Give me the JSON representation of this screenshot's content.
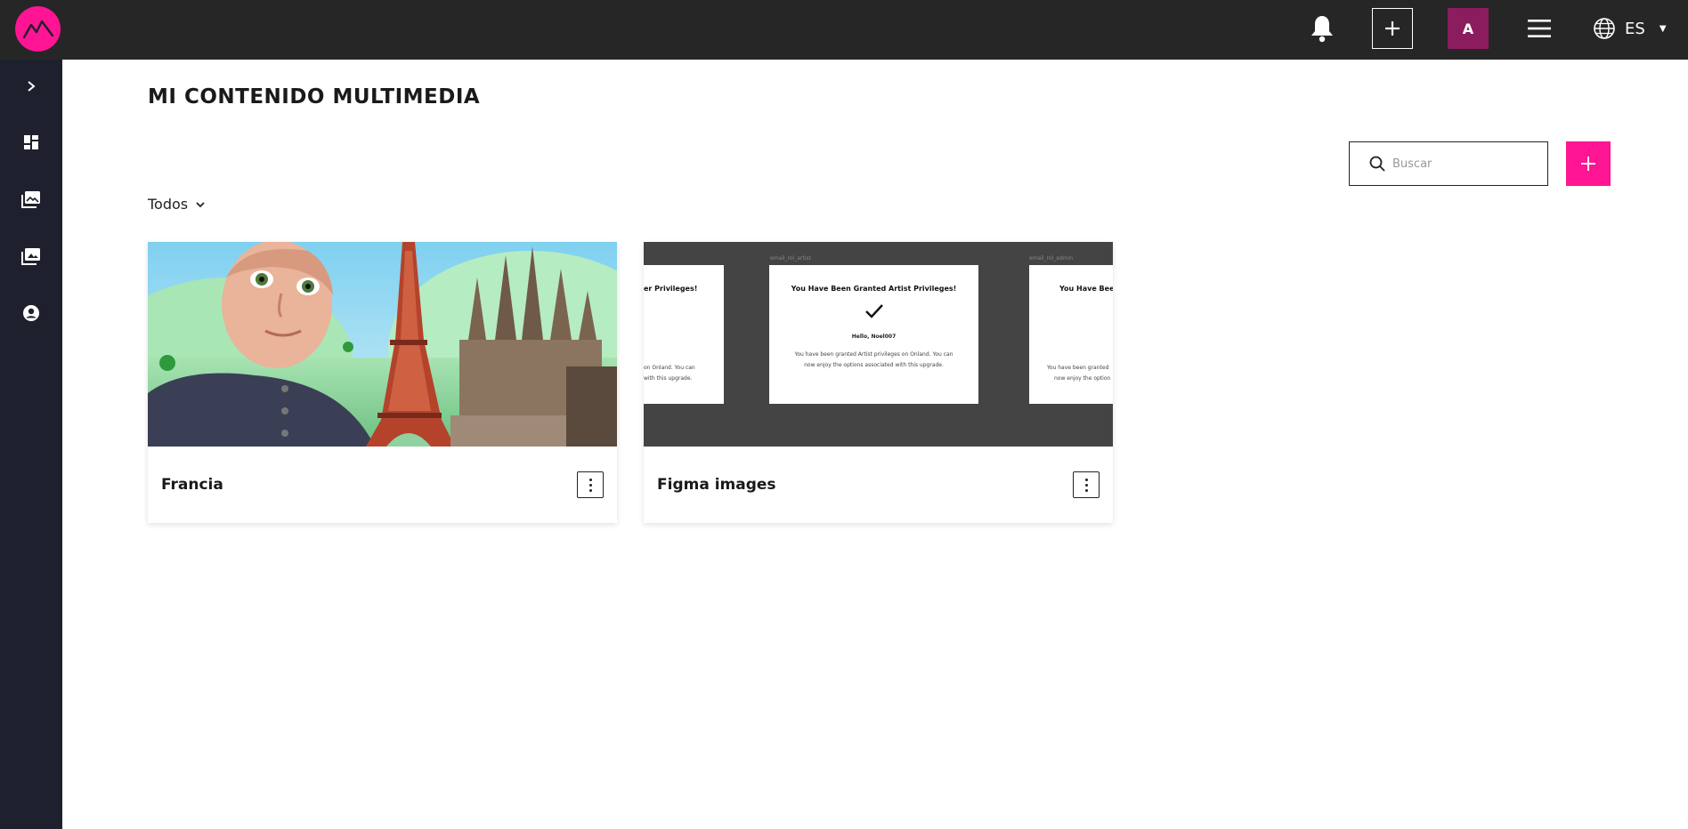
{
  "topbar": {
    "avatar_initial": "A",
    "language": "ES"
  },
  "page": {
    "title": "MI CONTENIDO MULTIMEDIA"
  },
  "search": {
    "placeholder": "Buscar"
  },
  "filter": {
    "label": "Todos"
  },
  "cards": [
    {
      "title": "Francia"
    },
    {
      "title": "Figma images",
      "preview": {
        "caption_center": "email_rol_artist",
        "caption_right": "email_rol_admin",
        "left_heading": "er Privileges!",
        "left_body_1": "on Onland. You can",
        "left_body_2": "with this upgrade.",
        "center_heading": "You Have Been Granted Artist Privileges!",
        "center_hello": "Hello, Noel007",
        "center_body_1": "You have been granted Artist privileges on Onland. You can",
        "center_body_2": "now enjoy the options associated with this upgrade.",
        "right_heading": "You Have Been",
        "right_body_1": "You have been granted",
        "right_body_2": "now enjoy the option"
      }
    }
  ],
  "colors": {
    "brand_pink": "#ff1493",
    "avatar_bg": "#8b1c5d",
    "topbar_bg": "#262626",
    "sidebar_bg": "#1e212d"
  }
}
